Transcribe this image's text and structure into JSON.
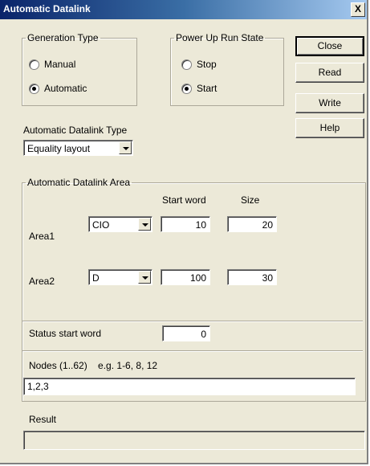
{
  "window": {
    "title": "Automatic Datalink",
    "close_glyph": "X"
  },
  "generation_type": {
    "legend": "Generation Type",
    "options": [
      {
        "label": "Manual",
        "checked": false
      },
      {
        "label": "Automatic",
        "checked": true
      }
    ]
  },
  "power_up": {
    "legend": "Power Up Run State",
    "options": [
      {
        "label": "Stop",
        "checked": false
      },
      {
        "label": "Start",
        "checked": true
      }
    ]
  },
  "buttons": {
    "close": "Close",
    "read": "Read",
    "write": "Write",
    "help": "Help"
  },
  "datalink_type": {
    "label": "Automatic Datalink Type",
    "value": "Equality layout"
  },
  "area_group": {
    "legend": "Automatic Datalink Area",
    "col_start": "Start word",
    "col_size": "Size",
    "rows": [
      {
        "label": "Area1",
        "type": "CIO",
        "start": "10",
        "size": "20"
      },
      {
        "label": "Area2",
        "type": "D",
        "start": "100",
        "size": "30"
      }
    ],
    "status_label": "Status start word",
    "status_value": "0",
    "nodes_label": "Nodes (1..62)    e.g. 1-6, 8, 12",
    "nodes_value": "1,2,3"
  },
  "result": {
    "label": "Result",
    "value": ""
  }
}
